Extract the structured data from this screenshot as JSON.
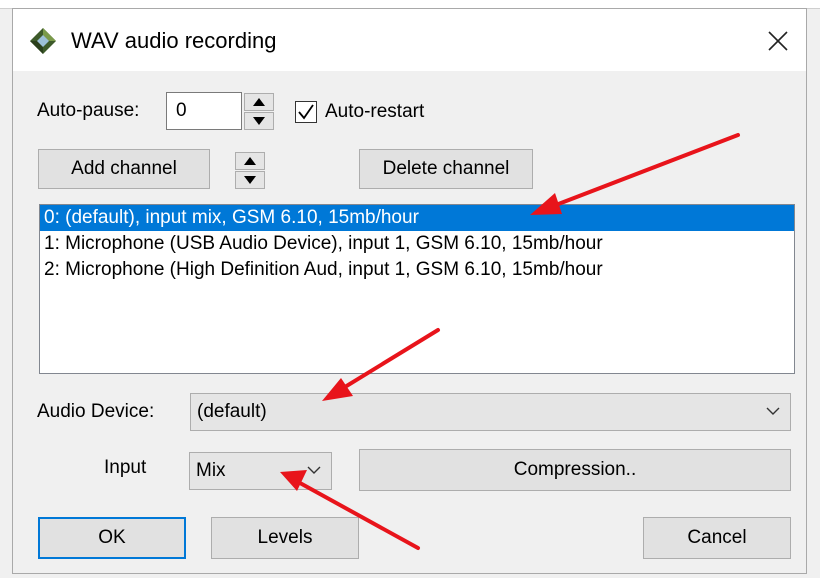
{
  "window": {
    "title": "WAV audio recording",
    "icons": {
      "app": "diamond-app-icon",
      "close": "close-icon"
    }
  },
  "auto_pause": {
    "label": "Auto-pause:",
    "value": "0"
  },
  "auto_restart": {
    "label": "Auto-restart",
    "checked": true
  },
  "channels": {
    "add_label": "Add channel",
    "delete_label": "Delete channel",
    "items": [
      {
        "text": "0: (default), input mix, GSM 6.10, 15mb/hour",
        "selected": true
      },
      {
        "text": "1: Microphone (USB Audio Device), input 1, GSM 6.10, 15mb/hour",
        "selected": false
      },
      {
        "text": "2: Microphone (High Definition Aud, input 1, GSM 6.10, 15mb/hour",
        "selected": false
      }
    ]
  },
  "audio_device": {
    "label": "Audio Device:",
    "value": "(default)"
  },
  "input": {
    "label": "Input",
    "value": "Mix"
  },
  "buttons": {
    "compression": "Compression..",
    "ok": "OK",
    "levels": "Levels",
    "cancel": "Cancel"
  },
  "colors": {
    "selection": "#0078d7",
    "annotation_arrow": "#e8141b",
    "window_bg": "#f0f0f0"
  }
}
